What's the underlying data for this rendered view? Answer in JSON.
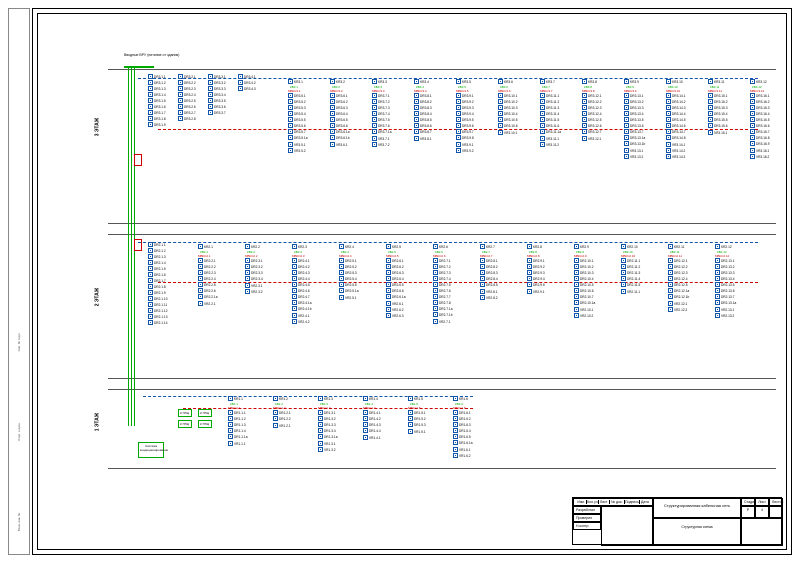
{
  "meta": {
    "supply_label": "Вводные ВРУ\n(питание от здания)",
    "floors": [
      "3 ЭТАЖ",
      "2 ЭТАЖ",
      "1 ЭТАЖ"
    ],
    "equipment_box": "Система\nкондиционирования",
    "ups_labels": [
      "К ГРЩ",
      "К ГРЩ",
      "К ГРЩ",
      "К ГРЩ"
    ]
  },
  "titleblock": {
    "title1": "Структурированная кабельная сеть",
    "title2": "Структурная схема",
    "col_headers": [
      "Изм.",
      "Кол.уч",
      "Лист",
      "№ док.",
      "Подпись",
      "Дата"
    ],
    "rows_left": [
      "Разработал",
      "Проверил",
      "Н.контр."
    ],
    "stage_h": "Стадия",
    "sheet_h": "Лист",
    "sheets_h": "Листов",
    "stage": "Р",
    "sheet": "4",
    "sheets": ""
  },
  "sidebar": {
    "cells": [
      "Взам. инв. №",
      "Подп. и дата",
      "Инв. № подл."
    ]
  },
  "prefixes": {
    "dr": "DR",
    "kr": "KR",
    "vr": "VR",
    "cabk": "КВ",
    "cabm": "МВКС"
  },
  "floor3": {
    "left_stack": [
      [
        "3.1.1",
        "3.1.2",
        "3.1.3",
        "3.1.4",
        "3.1.5",
        "3.1.6",
        "3.1.7",
        "3.1.8",
        "3.1.9"
      ],
      [
        "3.2.1",
        "3.2.2",
        "3.2.3",
        "3.2.4",
        "3.2.5",
        "3.2.6",
        "3.2.7",
        "3.2.8"
      ],
      [
        "3.3.1",
        "3.3.2",
        "3.3.3",
        "3.3.4",
        "3.3.5",
        "3.3.6",
        "3.3.7"
      ],
      [
        "3.4.1",
        "3.4.2",
        "3.4.3"
      ]
    ],
    "groups": [
      {
        "k": "3.1",
        "items": [
          "3.5.1",
          "3.5.2",
          "3.5.3",
          "3.5.4",
          "3.5.5",
          "3.5.6",
          "3.5.7"
        ],
        "extra": [
          "3.5.1a"
        ],
        "vr": [
          "3.5.1",
          "3.5.2"
        ]
      },
      {
        "k": "3.2",
        "items": [
          "3.6.1",
          "3.6.2",
          "3.6.3",
          "3.6.4",
          "3.6.5",
          "3.6.6"
        ],
        "extra": [
          "3.6.1a",
          "3.6.1b"
        ],
        "vr": [
          "3.6.1"
        ]
      },
      {
        "k": "3.3",
        "items": [
          "3.7.1",
          "3.7.2",
          "3.7.3",
          "3.7.4",
          "3.7.5",
          "3.7.6"
        ],
        "extra": [
          "3.7.1a"
        ],
        "vr": [
          "3.7.1",
          "3.7.2"
        ]
      },
      {
        "k": "3.4",
        "items": [
          "3.8.1",
          "3.8.2",
          "3.8.3",
          "3.8.4",
          "3.8.5",
          "3.8.6",
          "3.8.7"
        ],
        "vr": [
          "3.8.1"
        ]
      },
      {
        "k": "3.5",
        "items": [
          "3.9.1",
          "3.9.2",
          "3.9.3",
          "3.9.4",
          "3.9.5",
          "3.9.6",
          "3.9.7",
          "3.9.8"
        ],
        "vr": [
          "3.9.1",
          "3.9.2"
        ]
      },
      {
        "k": "3.6",
        "items": [
          "3.10.1",
          "3.10.2",
          "3.10.3",
          "3.10.4",
          "3.10.5",
          "3.10.6"
        ],
        "vr": [
          "3.10.1"
        ]
      },
      {
        "k": "3.7",
        "items": [
          "3.11.1",
          "3.11.2",
          "3.11.3",
          "3.11.4",
          "3.11.5",
          "3.11.6"
        ],
        "extra": [
          "3.11.1a"
        ],
        "vr": [
          "3.11.1",
          "3.11.2"
        ]
      },
      {
        "k": "3.8",
        "items": [
          "3.12.1",
          "3.12.2",
          "3.12.3",
          "3.12.4",
          "3.12.5",
          "3.12.6",
          "3.12.7"
        ],
        "vr": [
          "3.12.1"
        ]
      },
      {
        "k": "3.9",
        "items": [
          "3.13.1",
          "3.13.2",
          "3.13.3",
          "3.13.4",
          "3.13.5",
          "3.13.6",
          "3.13.7"
        ],
        "extra": [
          "3.13.1a",
          "3.13.1b"
        ],
        "vr": [
          "3.13.1",
          "3.13.2"
        ]
      },
      {
        "k": "3.10",
        "items": [
          "3.14.1",
          "3.14.2",
          "3.14.3",
          "3.14.4",
          "3.14.5",
          "3.14.6",
          "3.14.7",
          "3.14.8"
        ],
        "vr": [
          "3.14.1",
          "3.14.2",
          "3.14.3"
        ]
      },
      {
        "k": "3.11",
        "items": [
          "3.15.1",
          "3.15.2",
          "3.15.3",
          "3.15.4",
          "3.15.5",
          "3.15.6"
        ],
        "vr": [
          "3.15.1"
        ]
      },
      {
        "k": "3.12",
        "items": [
          "3.16.1",
          "3.16.2",
          "3.16.3",
          "3.16.4",
          "3.16.5",
          "3.16.6",
          "3.16.7",
          "3.16.8",
          "3.16.9"
        ],
        "vr": [
          "3.16.1",
          "3.16.2"
        ]
      }
    ]
  },
  "floor2": {
    "left_stack": [
      [
        "2.1.1",
        "2.1.2",
        "2.1.3",
        "2.1.4",
        "2.1.5",
        "2.1.6",
        "2.1.7",
        "2.1.8",
        "2.1.9",
        "2.1.10",
        "2.1.11",
        "2.1.12",
        "2.1.13",
        "2.1.14"
      ]
    ],
    "groups": [
      {
        "k": "2.1",
        "items": [
          "2.2.1",
          "2.2.2",
          "2.2.3",
          "2.2.4",
          "2.2.5",
          "2.2.6"
        ],
        "extra": [
          "2.2.1a"
        ],
        "vr": [
          "2.2.1"
        ]
      },
      {
        "k": "2.2",
        "items": [
          "2.3.1",
          "2.3.2",
          "2.3.3",
          "2.3.4"
        ],
        "vr": [
          "2.3.1",
          "2.3.2"
        ]
      },
      {
        "k": "2.3",
        "items": [
          "2.4.1",
          "2.4.2",
          "2.4.3",
          "2.4.4",
          "2.4.5",
          "2.4.6",
          "2.4.7"
        ],
        "extra": [
          "2.4.1a",
          "2.4.1b"
        ],
        "vr": [
          "2.4.1",
          "2.4.2"
        ]
      },
      {
        "k": "2.4",
        "items": [
          "2.5.1",
          "2.5.2",
          "2.5.3",
          "2.5.4",
          "2.5.5"
        ],
        "extra": [
          "2.5.1a"
        ],
        "vr": [
          "2.5.1"
        ]
      },
      {
        "k": "2.5",
        "items": [
          "2.6.1",
          "2.6.2",
          "2.6.3",
          "2.6.4",
          "2.6.5",
          "2.6.6"
        ],
        "extra": [
          "2.6.1a"
        ],
        "vr": [
          "2.6.1",
          "2.6.2",
          "2.6.3"
        ]
      },
      {
        "k": "2.6",
        "items": [
          "2.7.1",
          "2.7.2",
          "2.7.3",
          "2.7.4",
          "2.7.5",
          "2.7.6",
          "2.7.7",
          "2.7.8"
        ],
        "extra": [
          "2.7.1a",
          "2.7.1b"
        ],
        "vr": [
          "2.7.1"
        ]
      },
      {
        "k": "2.7",
        "items": [
          "2.8.1",
          "2.8.2",
          "2.8.3",
          "2.8.4",
          "2.8.5"
        ],
        "vr": [
          "2.8.1",
          "2.8.2"
        ]
      },
      {
        "k": "2.8",
        "items": [
          "2.9.1",
          "2.9.2",
          "2.9.3",
          "2.9.4",
          "2.9.5"
        ],
        "vr": [
          "2.9.1"
        ]
      },
      {
        "k": "2.9",
        "items": [
          "2.10.1",
          "2.10.2",
          "2.10.3",
          "2.10.4",
          "2.10.5",
          "2.10.6",
          "2.10.7"
        ],
        "extra": [
          "2.10.1a"
        ],
        "vr": [
          "2.10.1",
          "2.10.2"
        ]
      },
      {
        "k": "2.10",
        "items": [
          "2.11.1",
          "2.11.2",
          "2.11.3",
          "2.11.4",
          "2.11.5"
        ],
        "vr": [
          "2.11.1"
        ]
      },
      {
        "k": "2.11",
        "items": [
          "2.12.1",
          "2.12.2",
          "2.12.3",
          "2.12.4",
          "2.12.5"
        ],
        "extra": [
          "2.12.1a",
          "2.12.1b"
        ],
        "vr": [
          "2.12.1",
          "2.12.2"
        ]
      },
      {
        "k": "2.12",
        "items": [
          "2.13.1",
          "2.13.2",
          "2.13.3",
          "2.13.4",
          "2.13.5",
          "2.13.6",
          "2.13.7"
        ],
        "extra": [
          "2.13.1a"
        ],
        "vr": [
          "2.13.1",
          "2.13.2"
        ]
      }
    ]
  },
  "floor1": {
    "groups": [
      {
        "k": "1.1",
        "items": [
          "1.1.1",
          "1.1.2",
          "1.1.3",
          "1.1.4"
        ],
        "extra": [
          "1.1.1a"
        ],
        "vr": [
          "1.1.1"
        ]
      },
      {
        "k": "1.2",
        "items": [
          "1.2.1",
          "1.2.2"
        ],
        "vr": [
          "1.2.1"
        ]
      },
      {
        "k": "1.3",
        "items": [
          "1.3.1",
          "1.3.2",
          "1.3.3",
          "1.3.4"
        ],
        "extra": [
          "1.3.1a"
        ],
        "vr": [
          "1.3.1",
          "1.3.2"
        ]
      },
      {
        "k": "1.4",
        "items": [
          "1.4.1",
          "1.4.2",
          "1.4.3",
          "1.4.4"
        ],
        "vr": [
          "1.4.1"
        ]
      },
      {
        "k": "1.5",
        "items": [
          "1.5.1",
          "1.5.2",
          "1.5.3"
        ],
        "vr": [
          "1.5.1"
        ]
      },
      {
        "k": "1.6",
        "items": [
          "1.6.1",
          "1.6.2",
          "1.6.3",
          "1.6.4",
          "1.6.5"
        ],
        "extra": [
          "1.6.1a"
        ],
        "vr": [
          "1.6.1",
          "1.6.2"
        ]
      }
    ]
  }
}
